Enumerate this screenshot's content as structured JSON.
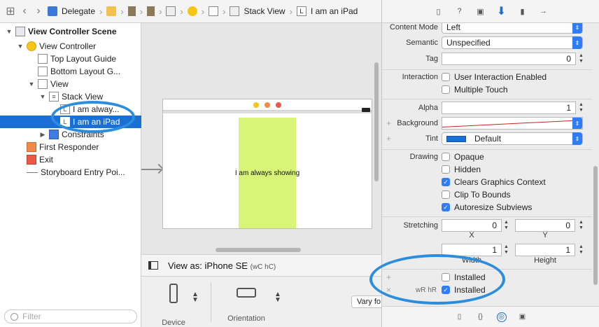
{
  "jumpbar": {
    "items": [
      {
        "label": "Delegate",
        "icon": "project-icon"
      },
      {
        "label": "",
        "icon": "folder-icon"
      },
      {
        "label": "",
        "icon": "storyboard-icon"
      },
      {
        "label": "",
        "icon": "storyboard-icon"
      },
      {
        "label": "",
        "icon": "scene-icon"
      },
      {
        "label": "",
        "icon": "view-controller-icon"
      },
      {
        "label": "",
        "icon": "view-icon"
      },
      {
        "label": "Stack View",
        "icon": "stack-view-icon"
      },
      {
        "label": "I am an iPad",
        "icon": "label-icon"
      }
    ]
  },
  "navigator": {
    "items": [
      {
        "label": "View Controller Scene",
        "bold": true
      },
      {
        "label": "View Controller"
      },
      {
        "label": "Top Layout Guide"
      },
      {
        "label": "Bottom Layout G..."
      },
      {
        "label": "View"
      },
      {
        "label": "Stack View"
      },
      {
        "label": "I am alway..."
      },
      {
        "label": "I am an iPad",
        "selected": true
      },
      {
        "label": "Constraints"
      },
      {
        "label": "First Responder"
      },
      {
        "label": "Exit"
      },
      {
        "label": "Storyboard Entry Poi..."
      }
    ],
    "filter_placeholder": "Filter"
  },
  "canvas": {
    "green_label": "I am always showing",
    "view_as": "View as: iPhone SE",
    "view_as_traits": "(wC hC)",
    "device_label": "Device",
    "orientation_label": "Orientation",
    "vary_button": "Vary fo"
  },
  "inspector": {
    "content_mode": {
      "label": "Content Mode",
      "value": "Left"
    },
    "semantic": {
      "label": "Semantic",
      "value": "Unspecified"
    },
    "tag": {
      "label": "Tag",
      "value": "0"
    },
    "interaction": {
      "label": "Interaction",
      "user_interaction": "User Interaction Enabled",
      "multiple_touch": "Multiple Touch"
    },
    "alpha": {
      "label": "Alpha",
      "value": "1"
    },
    "background": {
      "label": "Background"
    },
    "tint": {
      "label": "Tint",
      "value": "Default",
      "color": "#1a6fd6"
    },
    "drawing": {
      "label": "Drawing",
      "options": [
        {
          "label": "Opaque",
          "checked": false
        },
        {
          "label": "Hidden",
          "checked": false
        },
        {
          "label": "Clears Graphics Context",
          "checked": true
        },
        {
          "label": "Clip To Bounds",
          "checked": false
        },
        {
          "label": "Autoresize Subviews",
          "checked": true
        }
      ]
    },
    "stretching": {
      "label": "Stretching",
      "x": "0",
      "y": "0",
      "width": "1",
      "height": "1",
      "x_caption": "X",
      "y_caption": "Y",
      "width_caption": "Width",
      "height_caption": "Height"
    },
    "installed": [
      {
        "prefix": "+",
        "traits": "",
        "label": "Installed",
        "checked": false
      },
      {
        "prefix": "×",
        "traits": "wR hR",
        "label": "Installed",
        "checked": true
      }
    ]
  },
  "colors": {
    "accent": "#1a6fd6",
    "highlight_ring": "#2c8ddc",
    "green_view": "#d8f577"
  }
}
